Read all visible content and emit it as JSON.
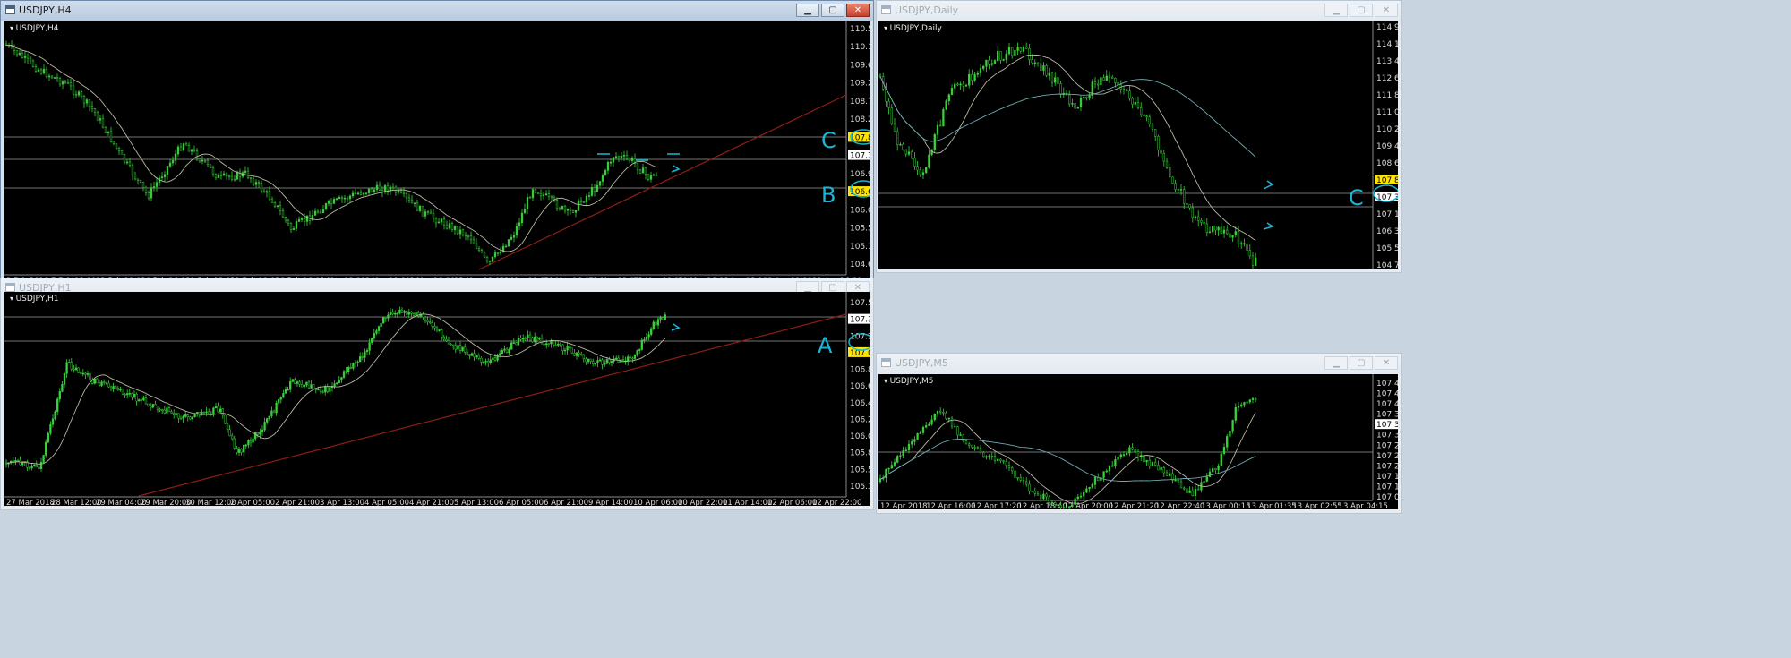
{
  "windows": {
    "h4": {
      "title": "USDJPY,H4",
      "chart_label": "USDJPY,H4",
      "price_labels": [
        "110.550",
        "110.100",
        "109.650",
        "109.200",
        "108.745",
        "108.295",
        "107.894",
        "107.338",
        "106.945",
        "106.605",
        "106.040",
        "105.590",
        "105.140",
        "104.690"
      ],
      "time_labels": [
        "2 Feb 2018",
        "7 Feb 08:00",
        "12 Feb 00:00",
        "14 Feb 16:00",
        "19 Feb 08:00",
        "22 Feb 00:00",
        "26 Feb 16:00",
        "1 Mar 08:00",
        "6 Mar 00:00",
        "8 Mar 16:00",
        "13 Mar 08:00",
        "16 Mar 00:00",
        "20 Mar 16:00",
        "23 Mar 08:00",
        "28 Mar 00:00",
        "30 Mar 16:00",
        "4 Apr 08:00",
        "9 Apr 00:00",
        "11 Apr 16:00"
      ],
      "annotations": [
        "C",
        "B"
      ]
    },
    "h1": {
      "title": "USDJPY,H1",
      "chart_label": "USDJPY,H1",
      "price_labels": [
        "107.500",
        "107.338",
        "107.290",
        "107.065",
        "106.865",
        "106.650",
        "106.435",
        "106.225",
        "106.010",
        "105.800",
        "105.585",
        "105.375"
      ],
      "time_labels": [
        "27 Mar 2018",
        "28 Mar 12:00",
        "29 Mar 04:00",
        "29 Mar 20:00",
        "30 Mar 12:00",
        "2 Apr 05:00",
        "2 Apr 21:00",
        "3 Apr 13:00",
        "4 Apr 05:00",
        "4 Apr 21:00",
        "5 Apr 13:00",
        "6 Apr 05:00",
        "6 Apr 21:00",
        "9 Apr 14:00",
        "10 Apr 06:00",
        "10 Apr 22:00",
        "11 Apr 14:00",
        "12 Apr 06:00",
        "12 Apr 22:00"
      ],
      "annotations": [
        "A"
      ]
    },
    "daily": {
      "title": "USDJPY,Daily",
      "chart_label": "USDJPY,Daily",
      "price_labels": [
        "114.980",
        "114.190",
        "113.410",
        "112.620",
        "111.840",
        "111.050",
        "110.260",
        "109.480",
        "108.690",
        "107.899",
        "107.338",
        "107.120",
        "106.340",
        "105.550",
        "104.770"
      ],
      "annotations": [
        "C"
      ]
    },
    "m5": {
      "title": "USDJPY,M5",
      "chart_label": "USDJPY,M5",
      "price_labels": [
        "107.485",
        "107.445",
        "107.405",
        "107.365",
        "107.338",
        "107.325",
        "107.285",
        "107.245",
        "107.205",
        "107.165",
        "107.125",
        "107.085"
      ],
      "time_labels": [
        "12 Apr 2018",
        "12 Apr 16:00",
        "12 Apr 17:20",
        "12 Apr 18:40",
        "12 Apr 20:00",
        "12 Apr 21:20",
        "12 Apr 22:40",
        "13 Apr 00:15",
        "13 Apr 01:35",
        "13 Apr 02:55",
        "13 Apr 04:15"
      ]
    }
  },
  "colors": {
    "candles": "#39d13b",
    "ma": "#b8b8a0",
    "trendline": "#8b1e16",
    "level": "#9a9a9a",
    "annotation": "#19b7d6",
    "highlight": "#ffe400"
  }
}
